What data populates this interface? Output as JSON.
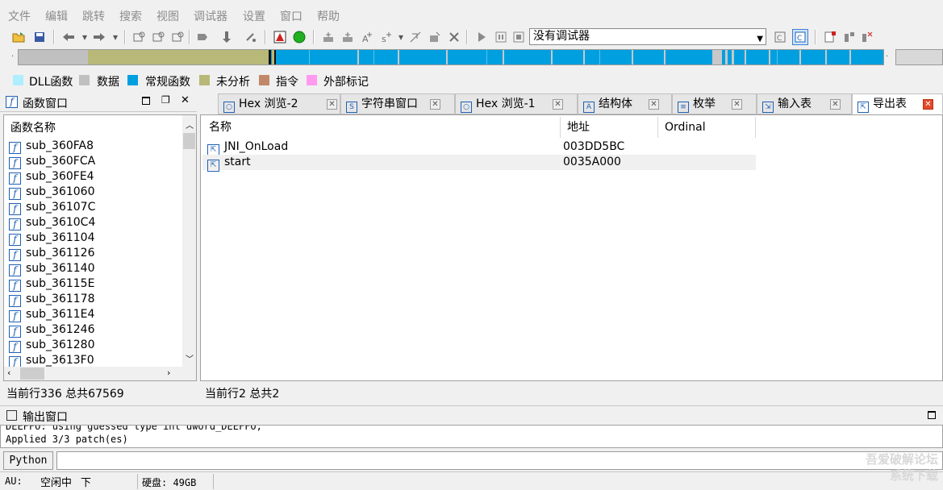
{
  "menu": [
    "文件",
    "编辑",
    "跳转",
    "搜索",
    "视图",
    "调试器",
    "设置",
    "窗口",
    "帮助"
  ],
  "toolbar": {
    "debugger_select_value": "没有调试器"
  },
  "colors": {
    "nav_library": "#00a0e0",
    "nav_unexplored": "#b8b878",
    "nav_data": "#c0c0c0",
    "tab_close_active": "#e04a2a"
  },
  "legend": [
    {
      "label": "DLL函数",
      "color": "#aeeeff"
    },
    {
      "label": "数据",
      "color": "#c0c0c0"
    },
    {
      "label": "常规函数",
      "color": "#00a0e0"
    },
    {
      "label": "未分析",
      "color": "#b8b878"
    },
    {
      "label": "指令",
      "color": "#c08868"
    },
    {
      "label": "外部标记",
      "color": "#ff9af0"
    }
  ],
  "functions_window": {
    "title": "函数窗口",
    "column_header": "函数名称",
    "items": [
      "sub_360FA8",
      "sub_360FCA",
      "sub_360FE4",
      "sub_361060",
      "sub_36107C",
      "sub_3610C4",
      "sub_361104",
      "sub_361126",
      "sub_361140",
      "sub_36115E",
      "sub_361178",
      "sub_3611E4",
      "sub_361246",
      "sub_361280",
      "sub_3613F0"
    ],
    "status": "当前行336 总共67569"
  },
  "tabs": [
    {
      "label": "Hex 浏览-2",
      "icon": "hex-view-icon"
    },
    {
      "label": "字符串窗口",
      "icon": "strings-icon"
    },
    {
      "label": "Hex 浏览-1",
      "icon": "hex-view-icon"
    },
    {
      "label": "结构体",
      "icon": "structures-icon"
    },
    {
      "label": "枚举",
      "icon": "enums-icon"
    },
    {
      "label": "输入表",
      "icon": "imports-icon"
    },
    {
      "label": "导出表",
      "icon": "exports-icon"
    }
  ],
  "exports": {
    "columns": [
      "名称",
      "地址",
      "Ordinal"
    ],
    "rows": [
      {
        "name": "JNI_OnLoad",
        "address": "003DD5BC",
        "ordinal": ""
      },
      {
        "name": "start",
        "address": "0035A000",
        "ordinal": ""
      }
    ],
    "status": "当前行2 总共2"
  },
  "output_window": {
    "title": "输出窗口",
    "lines": [
      "DEEFFO: using guessed type int dword_DEEFFO;",
      "Applied 3/3 patch(es)"
    ]
  },
  "cli": {
    "language": "Python",
    "value": ""
  },
  "bottom_status": {
    "au_label": "AU:",
    "au_state": "空闲中",
    "direction": "下",
    "disk": "硬盘: 49GB"
  },
  "watermark": [
    "吾爱破解论坛",
    "系统下载"
  ]
}
